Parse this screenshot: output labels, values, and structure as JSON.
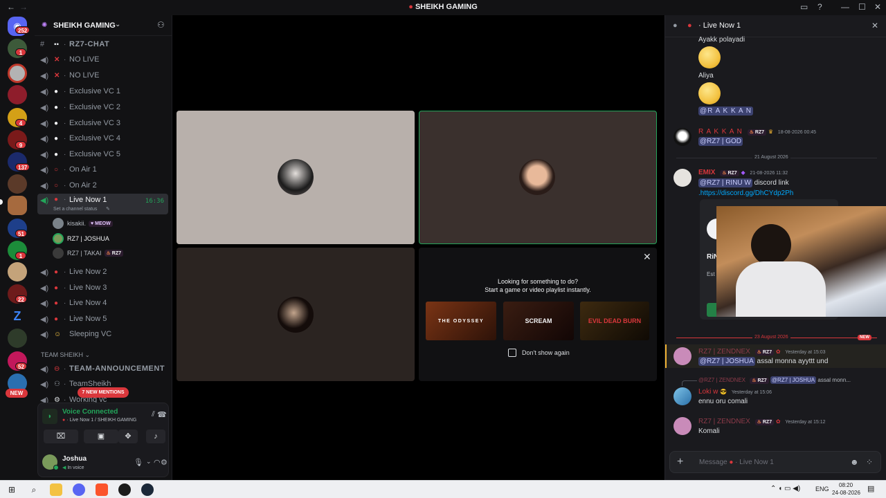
{
  "window": {
    "title": "SHEIKH GAMING",
    "back": "←",
    "forward": "→"
  },
  "rail": {
    "badges": [
      "252",
      "1",
      "4",
      "9",
      "137",
      "51",
      "1",
      "22",
      "52"
    ],
    "new_label": "NEW"
  },
  "sidebar": {
    "guild_name": "SHEIKH GAMING",
    "text_channel": "RZ7-CHAT",
    "channels": [
      {
        "name": "NO LIVE"
      },
      {
        "name": "NO LIVE"
      },
      {
        "name": "Exclusive VC 1"
      },
      {
        "name": "Exclusive VC 2"
      },
      {
        "name": "Exclusive VC 3"
      },
      {
        "name": "Exclusive VC 4"
      },
      {
        "name": "Exclusive VC 5"
      },
      {
        "name": "On Air 1"
      },
      {
        "name": "On Air 2"
      }
    ],
    "active_channel": {
      "name": "Live Now 1",
      "timer": "16:36",
      "status": "Set a channel status"
    },
    "voice_users": [
      {
        "name": "kisakii.",
        "tag": "MEOW"
      },
      {
        "name": "RZ7 | JOSHUA",
        "tag": ""
      },
      {
        "name": "RZ7 | TAKAI",
        "tag": "RZ7"
      }
    ],
    "more_channels": [
      {
        "name": "Live Now 2"
      },
      {
        "name": "Live Now 3"
      },
      {
        "name": "Live Now 4"
      },
      {
        "name": "Live Now 5"
      },
      {
        "name": "Sleeping VC"
      }
    ],
    "category": "TEAM SHEIKH",
    "announcement": "TEAM-ANNOUNCEMENT",
    "team_channel": "TeamSheikh",
    "working_channel": "Working vc",
    "mentions_pill": "7 NEW MENTIONS"
  },
  "user_panel": {
    "voice_status": "Voice Connected",
    "voice_location": "Live Now 1 / SHEIKH GAMING",
    "username": "Joshua",
    "user_status": "In voice"
  },
  "stage": {
    "activity_heading": "Looking for something to do?",
    "activity_sub": "Start a game or video playlist instantly.",
    "games": [
      "THE ODYSSEY",
      "SCREAM",
      "EVIL DEAD BURN"
    ],
    "dont_show": "Don't show again"
  },
  "chat": {
    "header": "Live Now 1",
    "date_divider_1": "21 August 2026",
    "date_divider_2": "23 August 2026",
    "new_label": "NEW",
    "messages": [
      {
        "author": "",
        "text": "Ayakk polayadi"
      },
      {
        "author": "",
        "text": "Aliya"
      },
      {
        "mention": "@R A K K A N"
      },
      {
        "author": "R A K K A N",
        "role": "RZ7",
        "time": "18-08-2026 00:45",
        "mention": "@RZ7 | GOD"
      },
      {
        "author": "EMIX",
        "role": "RZ7",
        "time": "21-08-2026 11:32",
        "mention": "@RZ7 | RINU W",
        "text": "discord link",
        "link": ".https://discord.gg/DhCYdp2Ph"
      },
      {
        "author": "RZ7 | ZENDNEX",
        "role": "RZ7",
        "time": "Yesterday at 15:03",
        "mention": "@RZ7 | JOSHUA",
        "text": "assal monna ayyttt und"
      },
      {
        "reply_author": "@RZ7 | ZENDNEX",
        "reply_role": "RZ7",
        "reply_mention": "@RZ7 | JOSHUA",
        "reply_text": "assal monn...",
        "author": "Loki w",
        "time": "Yesterday at 15:06",
        "text": "ennu oru comali"
      },
      {
        "author": "RZ7 | ZENDNEX",
        "role": "RZ7",
        "time": "Yesterday at 15:12",
        "text": "Komali"
      }
    ],
    "embed_name": "RiN",
    "embed_sub": "Est",
    "composer_placeholder": "Message",
    "composer_channel": "Live Now 1"
  },
  "taskbar": {
    "lang": "ENG",
    "time": "08:20",
    "date": "24-08-2026"
  }
}
